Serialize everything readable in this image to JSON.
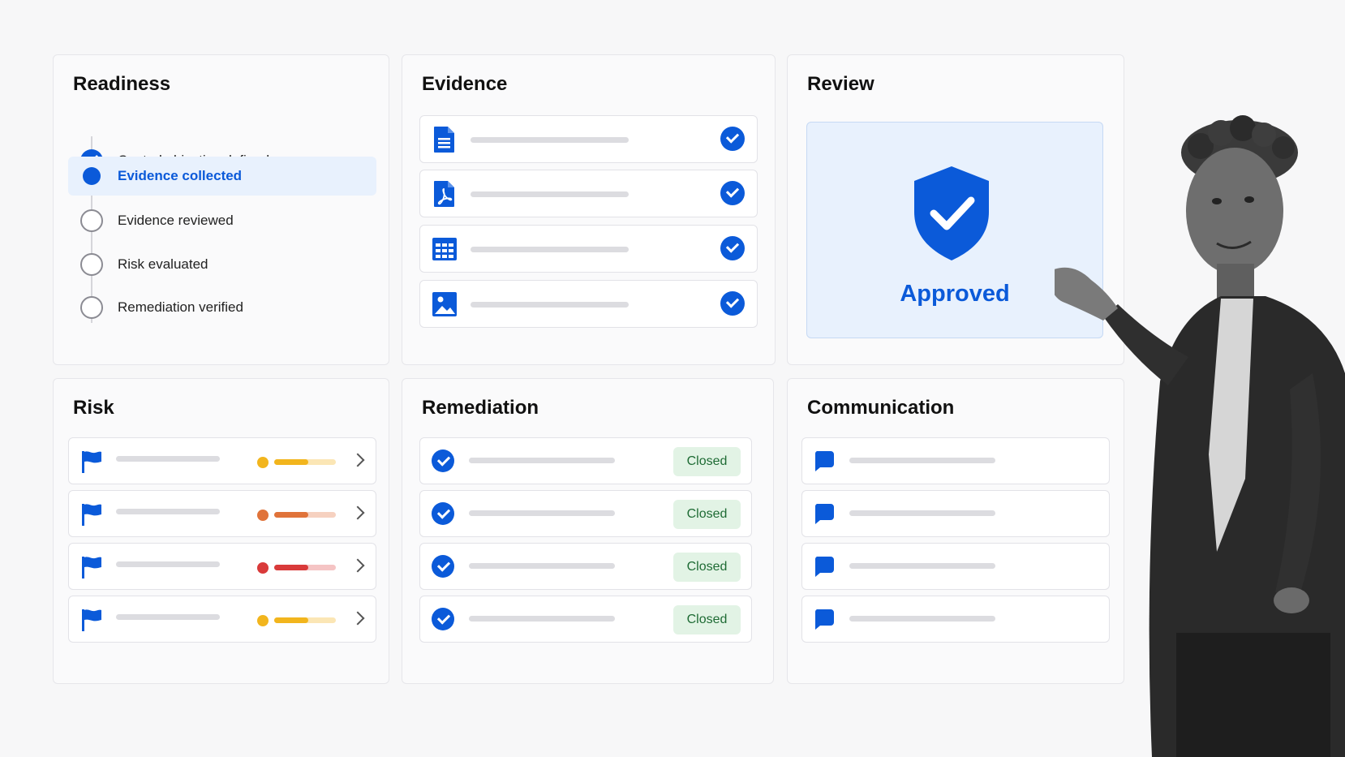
{
  "readiness": {
    "title": "Readiness",
    "items": [
      {
        "label": "Control objective defined",
        "state": "done"
      },
      {
        "label": "Evidence collected",
        "state": "current"
      },
      {
        "label": "Evidence reviewed",
        "state": "todo"
      },
      {
        "label": "Risk evaluated",
        "state": "todo"
      },
      {
        "label": "Remediation verified",
        "state": "todo"
      }
    ]
  },
  "evidence": {
    "title": "Evidence",
    "items": [
      {
        "icon": "document-icon",
        "status": "verified"
      },
      {
        "icon": "pdf-icon",
        "status": "verified"
      },
      {
        "icon": "spreadsheet-icon",
        "status": "verified"
      },
      {
        "icon": "image-icon",
        "status": "verified"
      }
    ]
  },
  "review": {
    "title": "Review",
    "status_label": "Approved",
    "icon": "shield-check-icon"
  },
  "risk": {
    "title": "Risk",
    "items": [
      {
        "icon": "flag-icon",
        "severity_color": "#f2b51d",
        "severity_track": "#fbe6b5",
        "severity_level": 0.55
      },
      {
        "icon": "flag-icon",
        "severity_color": "#e0733a",
        "severity_track": "#f6d1c0",
        "severity_level": 0.55
      },
      {
        "icon": "flag-icon",
        "severity_color": "#d93a3a",
        "severity_track": "#f5c4c4",
        "severity_level": 0.55
      },
      {
        "icon": "flag-icon",
        "severity_color": "#f2b51d",
        "severity_track": "#fbe6b5",
        "severity_level": 0.55
      }
    ]
  },
  "remediation": {
    "title": "Remediation",
    "items": [
      {
        "status": "Closed"
      },
      {
        "status": "Closed"
      },
      {
        "status": "Closed"
      },
      {
        "status": "Closed"
      }
    ]
  },
  "communication": {
    "title": "Communication",
    "items": [
      {
        "icon": "chat-bubble-icon"
      },
      {
        "icon": "chat-bubble-icon"
      },
      {
        "icon": "chat-bubble-icon"
      },
      {
        "icon": "chat-bubble-icon"
      }
    ]
  },
  "colors": {
    "accent": "#0b5ad9",
    "accent_light": "#e8f1fd",
    "closed_bg": "#e2f3e5",
    "closed_text": "#1e6b34"
  }
}
